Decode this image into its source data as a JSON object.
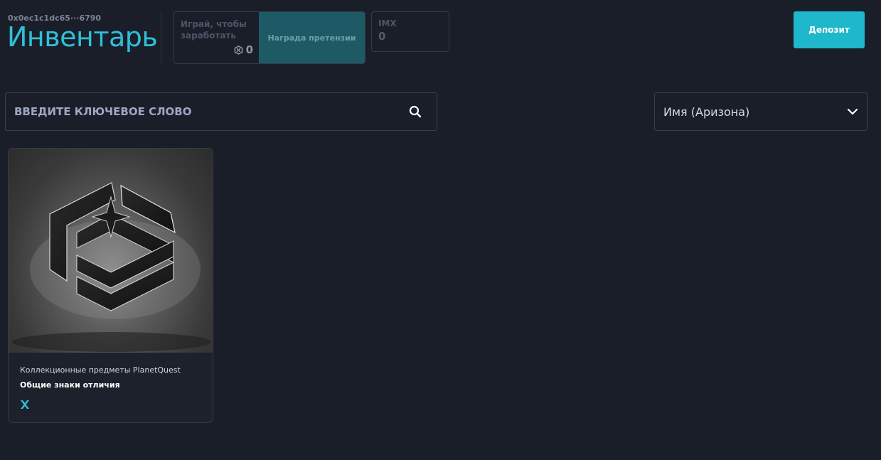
{
  "header": {
    "wallet": "0x0ec1c1dc65···6790",
    "title": "Инвентарь",
    "earn_label": "Играй, чтобы заработать",
    "earn_value": "0",
    "claim_label": "Награда претензии",
    "imx_label": "IMX",
    "imx_value": "0",
    "deposit_label": "Депозит"
  },
  "search": {
    "placeholder": "введите ключевое слово"
  },
  "sort": {
    "selected": "Имя (Аризона)"
  },
  "items": [
    {
      "collection": "Коллекционные предметы PlanetQuest",
      "name": "Общие знаки отличия",
      "chain_icon": "immutable-x-icon"
    }
  ],
  "colors": {
    "accent": "#1eb7cb",
    "title": "#2fc0d8",
    "background": "#1a1e29"
  }
}
